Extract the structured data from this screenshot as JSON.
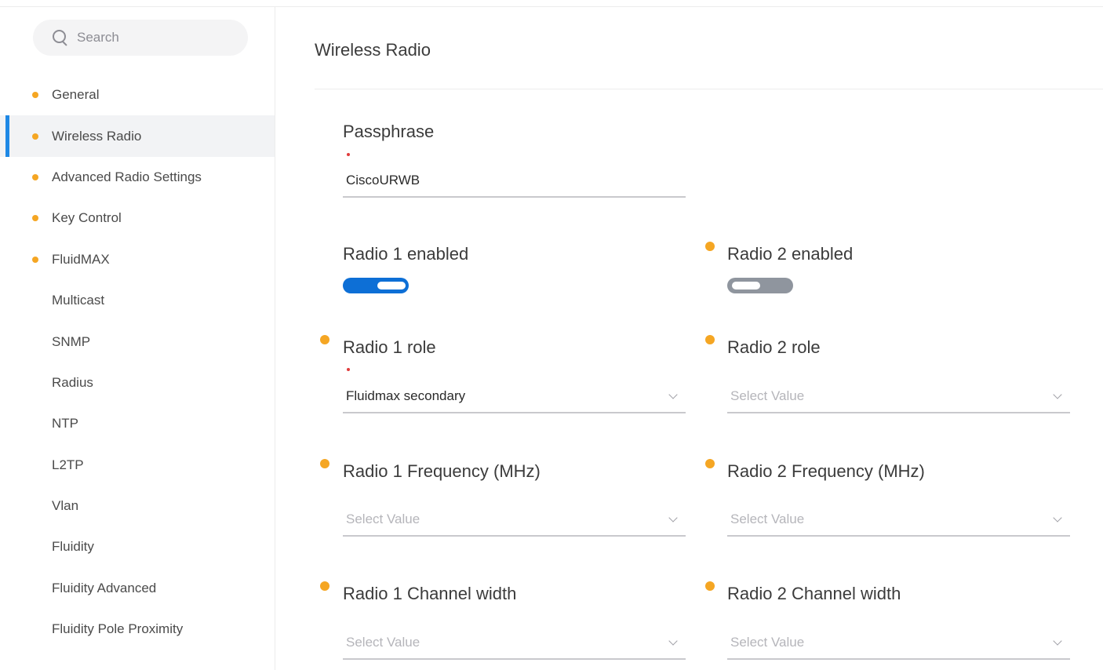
{
  "sidebar": {
    "search": {
      "placeholder": "Search"
    },
    "items": [
      {
        "label": "General",
        "modified": true,
        "active": false
      },
      {
        "label": "Wireless Radio",
        "modified": true,
        "active": true
      },
      {
        "label": "Advanced Radio Settings",
        "modified": true,
        "active": false
      },
      {
        "label": "Key Control",
        "modified": true,
        "active": false
      },
      {
        "label": "FluidMAX",
        "modified": true,
        "active": false
      },
      {
        "label": "Multicast",
        "modified": false,
        "active": false
      },
      {
        "label": "SNMP",
        "modified": false,
        "active": false
      },
      {
        "label": "Radius",
        "modified": false,
        "active": false
      },
      {
        "label": "NTP",
        "modified": false,
        "active": false
      },
      {
        "label": "L2TP",
        "modified": false,
        "active": false
      },
      {
        "label": "Vlan",
        "modified": false,
        "active": false
      },
      {
        "label": "Fluidity",
        "modified": false,
        "active": false
      },
      {
        "label": "Fluidity Advanced",
        "modified": false,
        "active": false
      },
      {
        "label": "Fluidity Pole Proximity",
        "modified": false,
        "active": false
      }
    ]
  },
  "main": {
    "title": "Wireless Radio",
    "passphrase": {
      "label": "Passphrase",
      "value": "CiscoURWB"
    },
    "radio1_enabled": {
      "label": "Radio 1 enabled",
      "on": true
    },
    "radio2_enabled": {
      "label": "Radio 2 enabled",
      "on": false
    },
    "radio1_role": {
      "label": "Radio 1 role",
      "value": "Fluidmax secondary"
    },
    "radio2_role": {
      "label": "Radio 2 role",
      "placeholder": "Select Value"
    },
    "radio1_frequency": {
      "label": "Radio 1 Frequency (MHz)",
      "placeholder": "Select Value"
    },
    "radio2_frequency": {
      "label": "Radio 2 Frequency (MHz)",
      "placeholder": "Select Value"
    },
    "radio1_channel_width": {
      "label": "Radio 1 Channel width",
      "placeholder": "Select Value"
    },
    "radio2_channel_width": {
      "label": "Radio 2 Channel width",
      "placeholder": "Select Value"
    }
  },
  "colors": {
    "accent": "#1e88e5",
    "toggle_on": "#0d6fd6",
    "toggle_off": "#8f959e",
    "modified_dot": "#f5a623",
    "required_mark": "#e03c3c"
  }
}
